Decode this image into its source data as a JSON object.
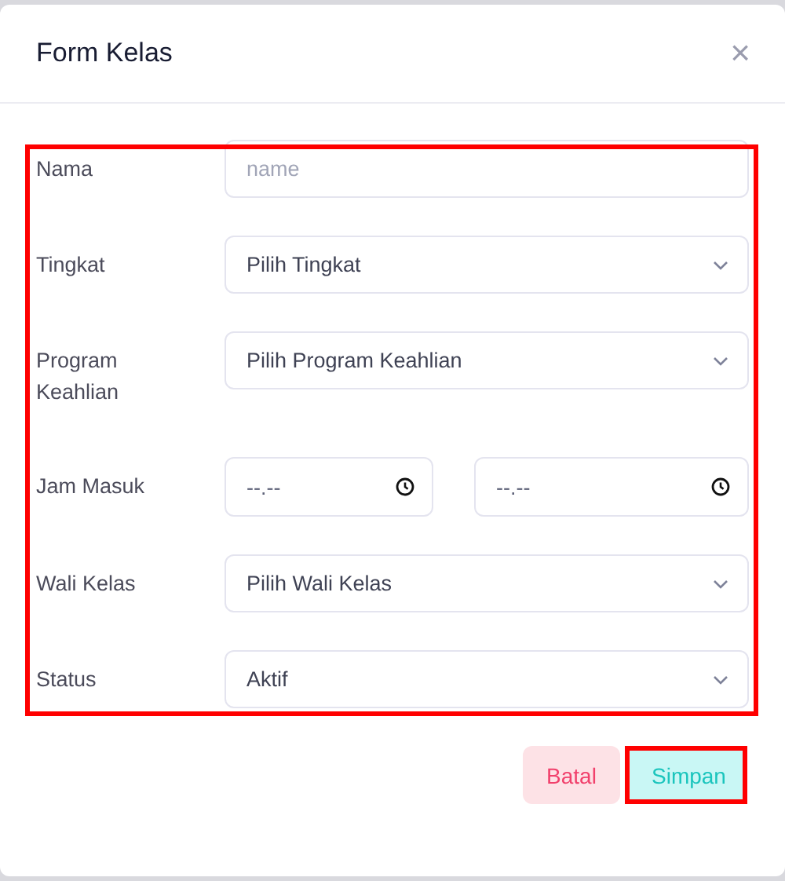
{
  "dialog": {
    "title": "Form Kelas",
    "close_icon": "×"
  },
  "form": {
    "highlighted": true,
    "fields": [
      {
        "kind": "text",
        "label": "Nama",
        "placeholder": "name"
      },
      {
        "kind": "select",
        "label": "Tingkat",
        "value": "Pilih Tingkat"
      },
      {
        "kind": "select",
        "label": "Program Keahlian",
        "value": "Pilih Program Keahlian"
      },
      {
        "kind": "time-range",
        "label": "Jam Masuk",
        "inputs": [
          {
            "placeholder": "--.--"
          },
          {
            "placeholder": "--.--"
          }
        ]
      },
      {
        "kind": "select",
        "label": "Wali Kelas",
        "value": "Pilih Wali Kelas"
      },
      {
        "kind": "select",
        "label": "Status",
        "value": "Aktif"
      }
    ]
  },
  "buttons": [
    {
      "kind": "cancel",
      "label": "Batal",
      "highlighted": false
    },
    {
      "kind": "save",
      "label": "Simpan",
      "highlighted": true
    }
  ]
}
